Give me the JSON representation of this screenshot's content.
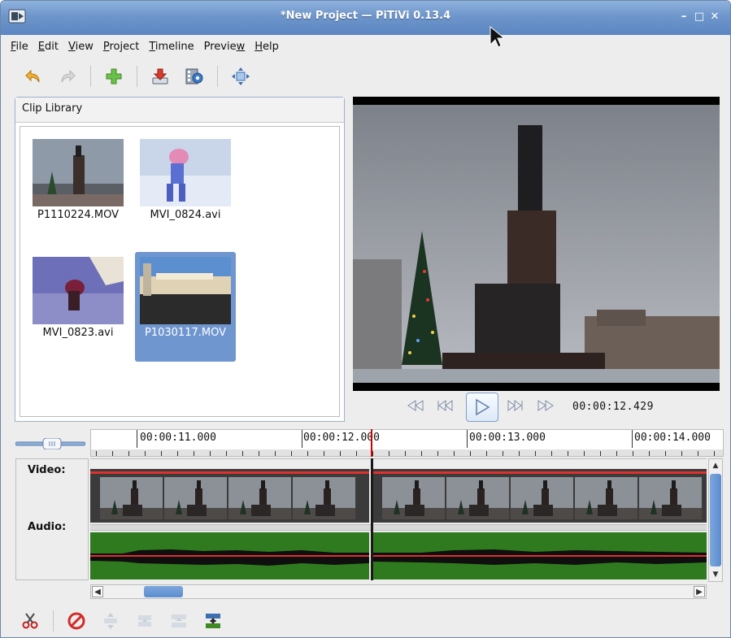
{
  "window": {
    "title": "*New Project — PiTiVi 0.13.4",
    "controls": {
      "minimize": "–",
      "maximize": "□",
      "close": "✕"
    }
  },
  "menu": [
    {
      "mnemonic": "F",
      "rest": "ile"
    },
    {
      "mnemonic": "E",
      "rest": "dit"
    },
    {
      "mnemonic": "V",
      "rest": "iew"
    },
    {
      "mnemonic": "P",
      "rest": "roject"
    },
    {
      "mnemonic": "T",
      "rest": "imeline"
    },
    {
      "pre": "Previe",
      "mnemonic": "w",
      "rest": ""
    },
    {
      "mnemonic": "H",
      "rest": "elp"
    }
  ],
  "toolbar_icons": [
    "undo-icon",
    "redo-icon",
    "add-clip-icon",
    "import-icon",
    "render-icon",
    "fullscreen-icon"
  ],
  "library": {
    "title": "Clip Library",
    "clips": [
      {
        "name": "P1110224.MOV",
        "selected": false
      },
      {
        "name": "MVI_0824.avi",
        "selected": false
      },
      {
        "name": "MVI_0823.avi",
        "selected": false
      },
      {
        "name": "P1030117.MOV",
        "selected": true
      }
    ]
  },
  "viewer": {
    "timecode": "00:00:12.429"
  },
  "timeline": {
    "ruler_labels": [
      "00:00:11.000",
      "00:00:12.000",
      "00:00:13.000",
      "00:00:14.000"
    ],
    "video_label": "Video:",
    "audio_label": "Audio:"
  },
  "colors": {
    "selection": "#6f96cf",
    "playhead": "#d40000",
    "audio_wave": "#2f7a1e",
    "titlebar": "#6e96cb"
  }
}
